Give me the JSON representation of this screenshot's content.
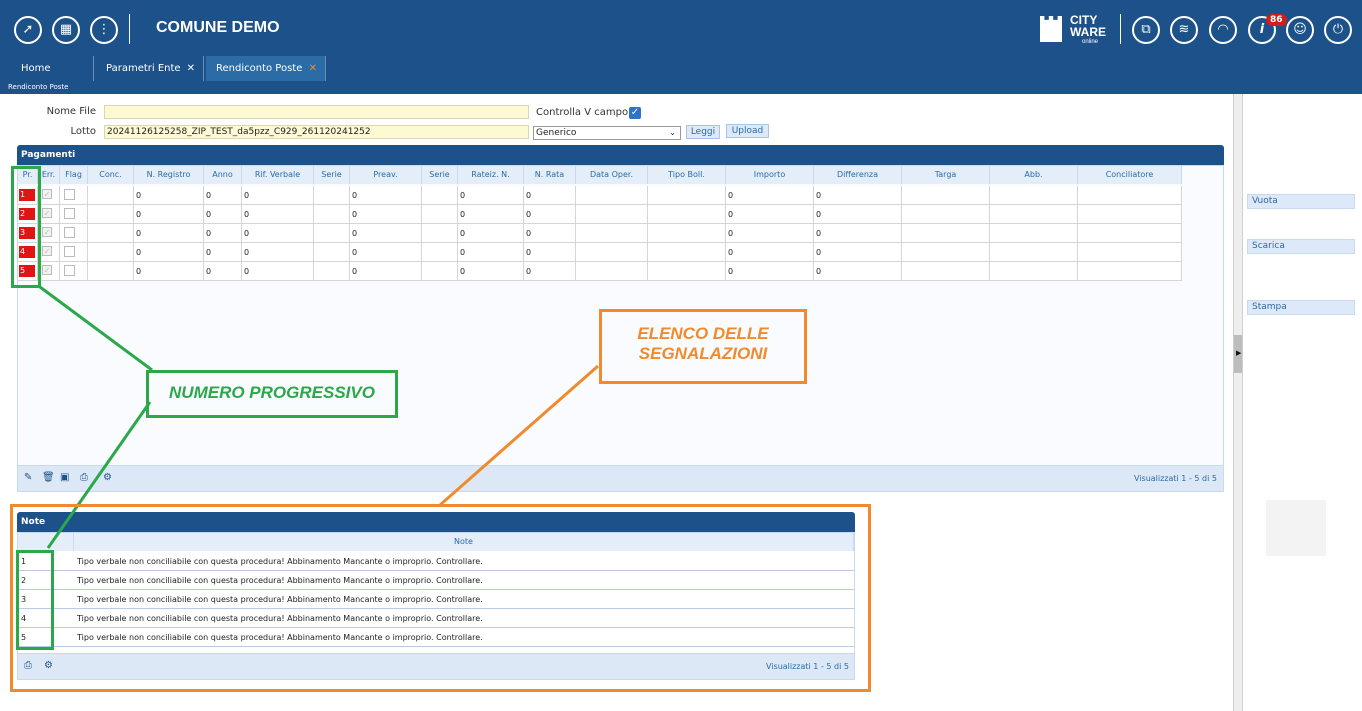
{
  "header": {
    "title": "COMUNE DEMO",
    "left_icons": [
      "rocket-icon",
      "grid-icon",
      "more-vertical-icon"
    ],
    "right_icons": [
      "windows-icon",
      "layers-icon",
      "headset-icon",
      "info-icon",
      "user-icon",
      "power-icon"
    ],
    "notification_count": "86",
    "logo": {
      "line1": "CITY",
      "line2": "WARE",
      "line3": "online"
    }
  },
  "tabs": [
    {
      "label": "Home",
      "closable": false
    },
    {
      "label": "Parametri Ente",
      "closable": true
    },
    {
      "label": "Rendiconto Poste",
      "closable": true,
      "active": true
    }
  ],
  "tab_close_glyph": "✕",
  "breadcrumb": "Rendiconto Poste",
  "form": {
    "nome_file_label": "Nome File",
    "nome_file_value": "",
    "controlla_label": "Controlla V campo",
    "controlla_checked": true,
    "lotto_label": "Lotto",
    "lotto_value": "20241126125258_ZIP_TEST_da5pzz_C929_261120241252",
    "select_value": "Generico",
    "leggi_label": "Leggi",
    "upload_label": "Upload"
  },
  "pagamenti": {
    "title": "Pagamenti",
    "columns": [
      "Pr.",
      "Err.",
      "Flag",
      "Conc.",
      "N. Registro",
      "Anno",
      "Rif. Verbale",
      "Serie",
      "Preav.",
      "Serie",
      "Rateiz. N.",
      "N. Rata",
      "Data Oper.",
      "Tipo Boll.",
      "Importo",
      "Differenza",
      "Targa",
      "Abb.",
      "Conciliatore"
    ],
    "rows": [
      {
        "pr": "1",
        "n_registro": "0",
        "anno": "0",
        "rif_verbale": "0",
        "preav": "0",
        "rateiz": "0",
        "n_rata": "0",
        "importo": "0",
        "differenza": "0"
      },
      {
        "pr": "2",
        "n_registro": "0",
        "anno": "0",
        "rif_verbale": "0",
        "preav": "0",
        "rateiz": "0",
        "n_rata": "0",
        "importo": "0",
        "differenza": "0"
      },
      {
        "pr": "3",
        "n_registro": "0",
        "anno": "0",
        "rif_verbale": "0",
        "preav": "0",
        "rateiz": "0",
        "n_rata": "0",
        "importo": "0",
        "differenza": "0"
      },
      {
        "pr": "4",
        "n_registro": "0",
        "anno": "0",
        "rif_verbale": "0",
        "preav": "0",
        "rateiz": "0",
        "n_rata": "0",
        "importo": "0",
        "differenza": "0"
      },
      {
        "pr": "5",
        "n_registro": "0",
        "anno": "0",
        "rif_verbale": "0",
        "preav": "0",
        "rateiz": "0",
        "n_rata": "0",
        "importo": "0",
        "differenza": "0"
      }
    ],
    "footer_icons": [
      "pencil-icon",
      "trash-icon",
      "save-icon",
      "print-icon",
      "gear-icon"
    ],
    "count_text": "Visualizzati 1 - 5 di 5"
  },
  "note": {
    "title": "Note",
    "column": "Note",
    "rows": [
      {
        "n": "1",
        "text": "Tipo verbale non conciliabile con questa procedura! Abbinamento Mancante o improprio. Controllare."
      },
      {
        "n": "2",
        "text": "Tipo verbale non conciliabile con questa procedura! Abbinamento Mancante o improprio. Controllare."
      },
      {
        "n": "3",
        "text": "Tipo verbale non conciliabile con questa procedura! Abbinamento Mancante o improprio. Controllare."
      },
      {
        "n": "4",
        "text": "Tipo verbale non conciliabile con questa procedura! Abbinamento Mancante o improprio. Controllare."
      },
      {
        "n": "5",
        "text": "Tipo verbale non conciliabile con questa procedura! Abbinamento Mancante o improprio. Controllare."
      }
    ],
    "footer_icons": [
      "print-icon",
      "gear-icon"
    ],
    "count_text": "Visualizzati 1 - 5 di 5"
  },
  "right_panel": {
    "buttons": [
      "Vuota",
      "Scarica",
      "Stampa"
    ]
  },
  "annotations": {
    "numero": "NUMERO PROGRESSIVO",
    "elenco_line1": "ELENCO DELLE",
    "elenco_line2": "SEGNALAZIONI",
    "green": "#2aa84a",
    "orange": "#f08a2c"
  },
  "colors": {
    "header": "#1d5189",
    "accent": "#2b6ba6",
    "error_red": "#e01414",
    "field_yellow": "#fdf9d3"
  }
}
